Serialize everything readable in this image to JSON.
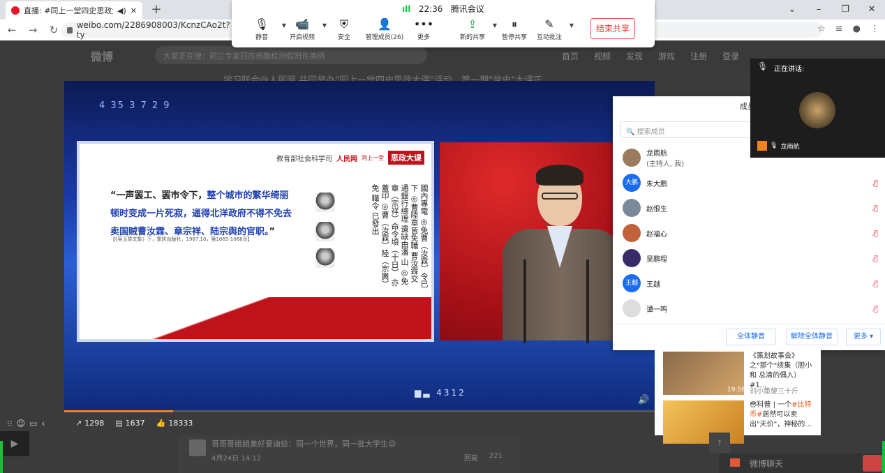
{
  "browser": {
    "tab_title": "直播: #同上一堂四史思政大",
    "url": "weibo.com/2286908003/KcnzCAo2t?ty",
    "window_controls": [
      "–",
      "❐",
      "✕"
    ]
  },
  "weibo": {
    "logo": "微博",
    "search_placeholder": "大家正在搜：莉兰专家回应核酸检测假阳性病例",
    "nav": [
      "首页",
      "视频",
      "发现",
      "游戏",
      "注册",
      "登录"
    ],
    "headline": "学习联合@人民网 共同举办\"同上一堂四史思政大课\"活动，第一期\"党史\"大课正"
  },
  "meeting": {
    "signal": "ıll",
    "time": "22:36",
    "app": "腾讯会议",
    "buttons": [
      {
        "label": "静音",
        "icon": "microphone-icon"
      },
      {
        "label": "开启视频",
        "icon": "video-off-icon"
      },
      {
        "label": "安全",
        "icon": "shield-icon"
      },
      {
        "label": "管理成员(26)",
        "icon": "members-icon"
      },
      {
        "label": "更多",
        "icon": "more-icon"
      },
      {
        "label": "新的共享",
        "icon": "share-icon"
      },
      {
        "label": "暂停共享",
        "icon": "pause-icon"
      },
      {
        "label": "互动批注",
        "icon": "annotate-icon"
      }
    ],
    "stop_share": "结束共享"
  },
  "player": {
    "top_numbers": "4    35  3    7    2  9",
    "bottom_numbers": "▆▃  4312",
    "slide": {
      "org": "教育部社会科学司",
      "logo": "人民网",
      "badge_small": "同上一堂",
      "badge_big": "思政大课",
      "quote_black1": "“一声罢工、罢市令下，",
      "quote_blue1": "整个城市的繁华绮丽",
      "quote_blue2": "顿时变成一片死寂，逼得北洋政府不得不免去",
      "quote_blue3": "卖国贼曹汝霖、章宗祥、陆宗舆的官职。",
      "quote_black2": "”",
      "citation": "【《英玉章文集》下，重庆出版社，1987.10，第1065-1066页】",
      "vertical_text": "國內專電 ◎免曹（汝霖）令已下 ◎曹陸章皆免職 曹汝霖交通銀行總理 遺缺由潘 山 ◎免章（宗祥）命令頃（十日） 亦蓋印 ◎曹（汝霖）陸（宗輿）免 職令 已發出"
    }
  },
  "stats": {
    "shares": "1298",
    "comments": "1637",
    "likes": "18333"
  },
  "comment": {
    "text": "哥哥哥姐姐美好爱迪些：同一个世界，同一批大学生😉",
    "date": "4月24日 14:12",
    "reply": "回复",
    "likes": "221"
  },
  "members": {
    "title": "成员",
    "search_placeholder": "搜索成员",
    "list": [
      {
        "name": "龙雨航",
        "sub": "(主持人, 我)",
        "avatar": ""
      },
      {
        "name": "朱大鹏",
        "sub": "",
        "avatar": "大鹏"
      },
      {
        "name": "赵恨生",
        "sub": "",
        "avatar": ""
      },
      {
        "name": "赵福心",
        "sub": "",
        "avatar": ""
      },
      {
        "name": "吴鹏程",
        "sub": "",
        "avatar": ""
      },
      {
        "name": "王越",
        "sub": "",
        "avatar": "王越"
      },
      {
        "name": "谭一鸣",
        "sub": "",
        "avatar": ""
      }
    ],
    "mute_all": "全体静音",
    "unmute_all": "解除全体静音",
    "more": "更多 ▾"
  },
  "speaking": {
    "label": "正在讲话:",
    "name": "龙雨航"
  },
  "recs": [
    {
      "title": "《策划故事会》之\"那个\"续集（胆小和 总清的偶入）#1…",
      "author": "刘小策傻三十斤",
      "duration": "19:56",
      "highlight": ""
    },
    {
      "title": "😳科普 | 一个",
      "highlight": "#比特币#",
      "title2": "居然可以卖出\"天价\"，神秘的…",
      "author": ""
    }
  ],
  "chat": {
    "label": "微博聊天"
  }
}
